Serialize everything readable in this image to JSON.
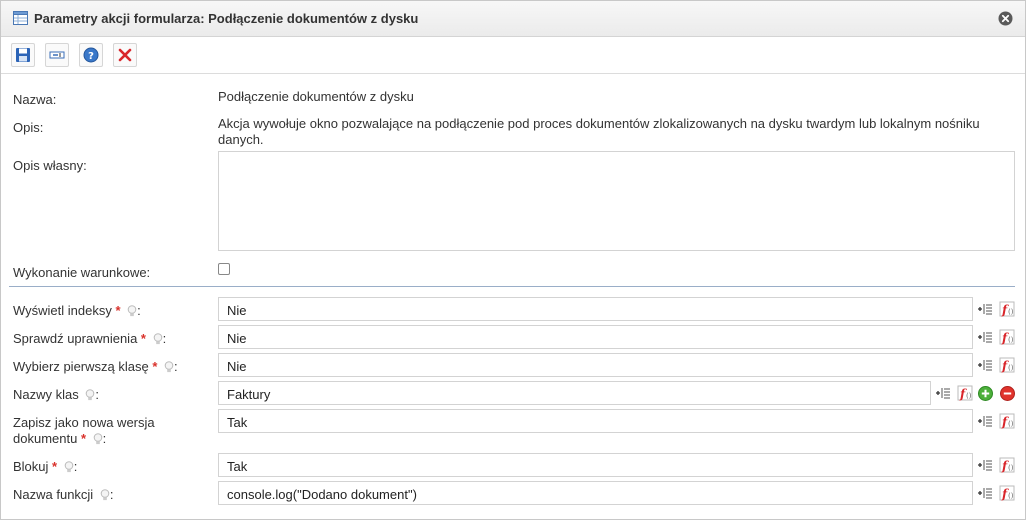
{
  "dialog": {
    "title": "Parametry akcji formularza: Podłączenie dokumentów z dysku"
  },
  "toolbar": {
    "buttons": [
      {
        "icon": "save-icon"
      },
      {
        "icon": "field-icon"
      },
      {
        "icon": "help-icon"
      },
      {
        "icon": "cancel-icon"
      }
    ]
  },
  "info": {
    "name_label": "Nazwa:",
    "name_value": "Podłączenie dokumentów z dysku",
    "desc_label": "Opis:",
    "desc_value": "Akcja wywołuje okno pozwalające na podłączenie pod proces dokumentów zlokalizowanych na dysku twardym lub lokalnym nośniku danych.",
    "own_desc_label": "Opis własny:",
    "own_desc_value": "",
    "conditional_label": "Wykonanie warunkowe:",
    "conditional_checked": false
  },
  "params": [
    {
      "label": "Wyświetl indeksy",
      "required": true,
      "value": "Nie"
    },
    {
      "label": "Sprawdź uprawnienia",
      "required": true,
      "value": "Nie"
    },
    {
      "label": "Wybierz pierwszą klasę",
      "required": true,
      "value": "Nie"
    },
    {
      "label": "Nazwy klas",
      "required": false,
      "value": "Faktury"
    },
    {
      "label_line1": "Zapisz jako nowa wersja",
      "label_line2": "dokumentu",
      "required": true,
      "value": "Tak"
    },
    {
      "label": "Blokuj",
      "required": true,
      "value": "Tak"
    },
    {
      "label": "Nazwa funkcji",
      "required": false,
      "value": "console.log(\"Dodano dokument\")"
    }
  ],
  "symbols": {
    "required_mark": "*",
    "colon": ":"
  }
}
